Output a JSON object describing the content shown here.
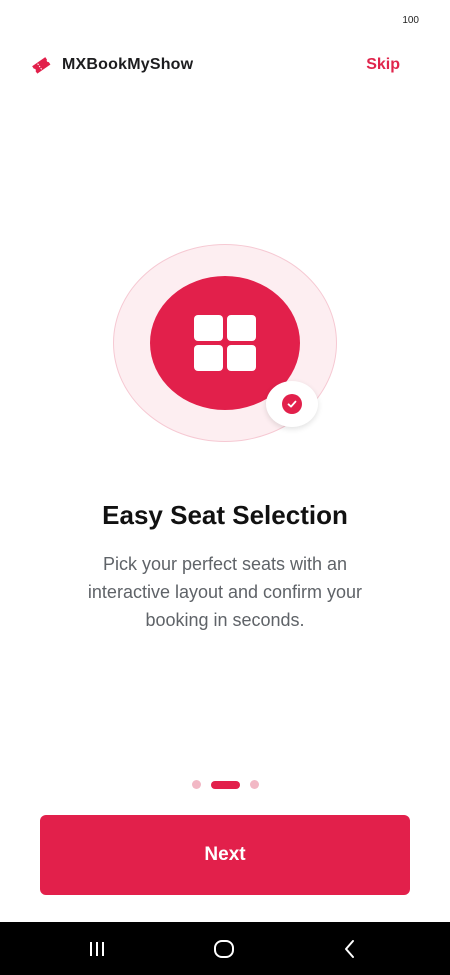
{
  "status_bar": {
    "battery": "100"
  },
  "header": {
    "brand_name": "MXBookMyShow",
    "brand_icon": "ticket-icon",
    "skip_label": "Skip"
  },
  "illustration": {
    "main_icon": "grid-icon",
    "badge_icon": "checkmark-icon"
  },
  "content": {
    "title": "Easy Seat Selection",
    "description": "Pick your perfect seats with an interactive layout and confirm your booking in seconds."
  },
  "pager": {
    "total_pages": 3,
    "current_page": 2
  },
  "actions": {
    "next_label": "Next"
  },
  "navigation": {
    "buttons": [
      "recent-apps-icon",
      "home-icon",
      "back-icon"
    ]
  },
  "colors": {
    "accent": "#e2204b",
    "accent_light": "#fdeef1",
    "dot_inactive": "#f2b8c5",
    "title_text": "#111111",
    "body_text": "#5f6368",
    "nav_bar": "#000000"
  }
}
